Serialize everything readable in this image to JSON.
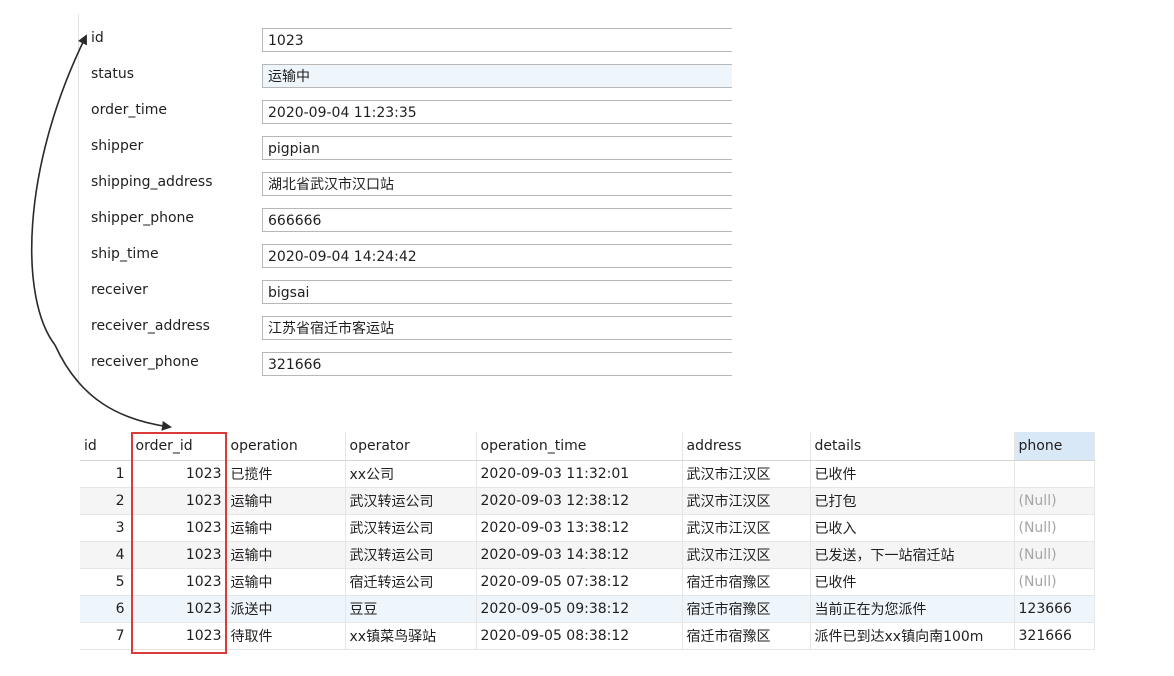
{
  "form": {
    "fields": [
      {
        "label": "id",
        "value": "1023"
      },
      {
        "label": "status",
        "value": "运输中"
      },
      {
        "label": "order_time",
        "value": "2020-09-04 11:23:35"
      },
      {
        "label": "shipper",
        "value": "pigpian"
      },
      {
        "label": "shipping_address",
        "value": "湖北省武汉市汉口站"
      },
      {
        "label": "shipper_phone",
        "value": "666666"
      },
      {
        "label": "ship_time",
        "value": "2020-09-04 14:24:42"
      },
      {
        "label": "receiver",
        "value": "bigsai"
      },
      {
        "label": "receiver_address",
        "value": "江苏省宿迁市客运站"
      },
      {
        "label": "receiver_phone",
        "value": "321666"
      }
    ],
    "selected_field": "status"
  },
  "grid": {
    "columns": [
      "id",
      "order_id",
      "operation",
      "operator",
      "operation_time",
      "address",
      "details",
      "phone"
    ],
    "highlighted_column": "phone",
    "rows": [
      [
        "1",
        "1023",
        "已揽件",
        "xx公司",
        "2020-09-03 11:32:01",
        "武汉市江汉区",
        "已收件",
        ""
      ],
      [
        "2",
        "1023",
        "运输中",
        "武汉转运公司",
        "2020-09-03 12:38:12",
        "武汉市江汉区",
        "已打包",
        "(Null)"
      ],
      [
        "3",
        "1023",
        "运输中",
        "武汉转运公司",
        "2020-09-03 13:38:12",
        "武汉市江汉区",
        "已收入",
        "(Null)"
      ],
      [
        "4",
        "1023",
        "运输中",
        "武汉转运公司",
        "2020-09-03 14:38:12",
        "武汉市江汉区",
        "已发送，下一站宿迁站",
        "(Null)"
      ],
      [
        "5",
        "1023",
        "运输中",
        "宿迁转运公司",
        "2020-09-05 07:38:12",
        "宿迁市宿豫区",
        "已收件",
        "(Null)"
      ],
      [
        "6",
        "1023",
        "派送中",
        "豆豆",
        "2020-09-05 09:38:12",
        "宿迁市宿豫区",
        "当前正在为您派件",
        "123666"
      ],
      [
        "7",
        "1023",
        "待取件",
        "xx镇菜鸟驿站",
        "2020-09-05 08:38:12",
        "宿迁市宿豫区",
        "派件已到达xx镇向南100m",
        "321666"
      ]
    ],
    "selected_row": 6
  },
  "colors": {
    "highlight_box": "#d93a3a",
    "arrow": "#2a2a2a",
    "selected_background": "#eef5fb",
    "header_highlight": "#d9e8f7",
    "null_text": "#a5a5a5"
  }
}
